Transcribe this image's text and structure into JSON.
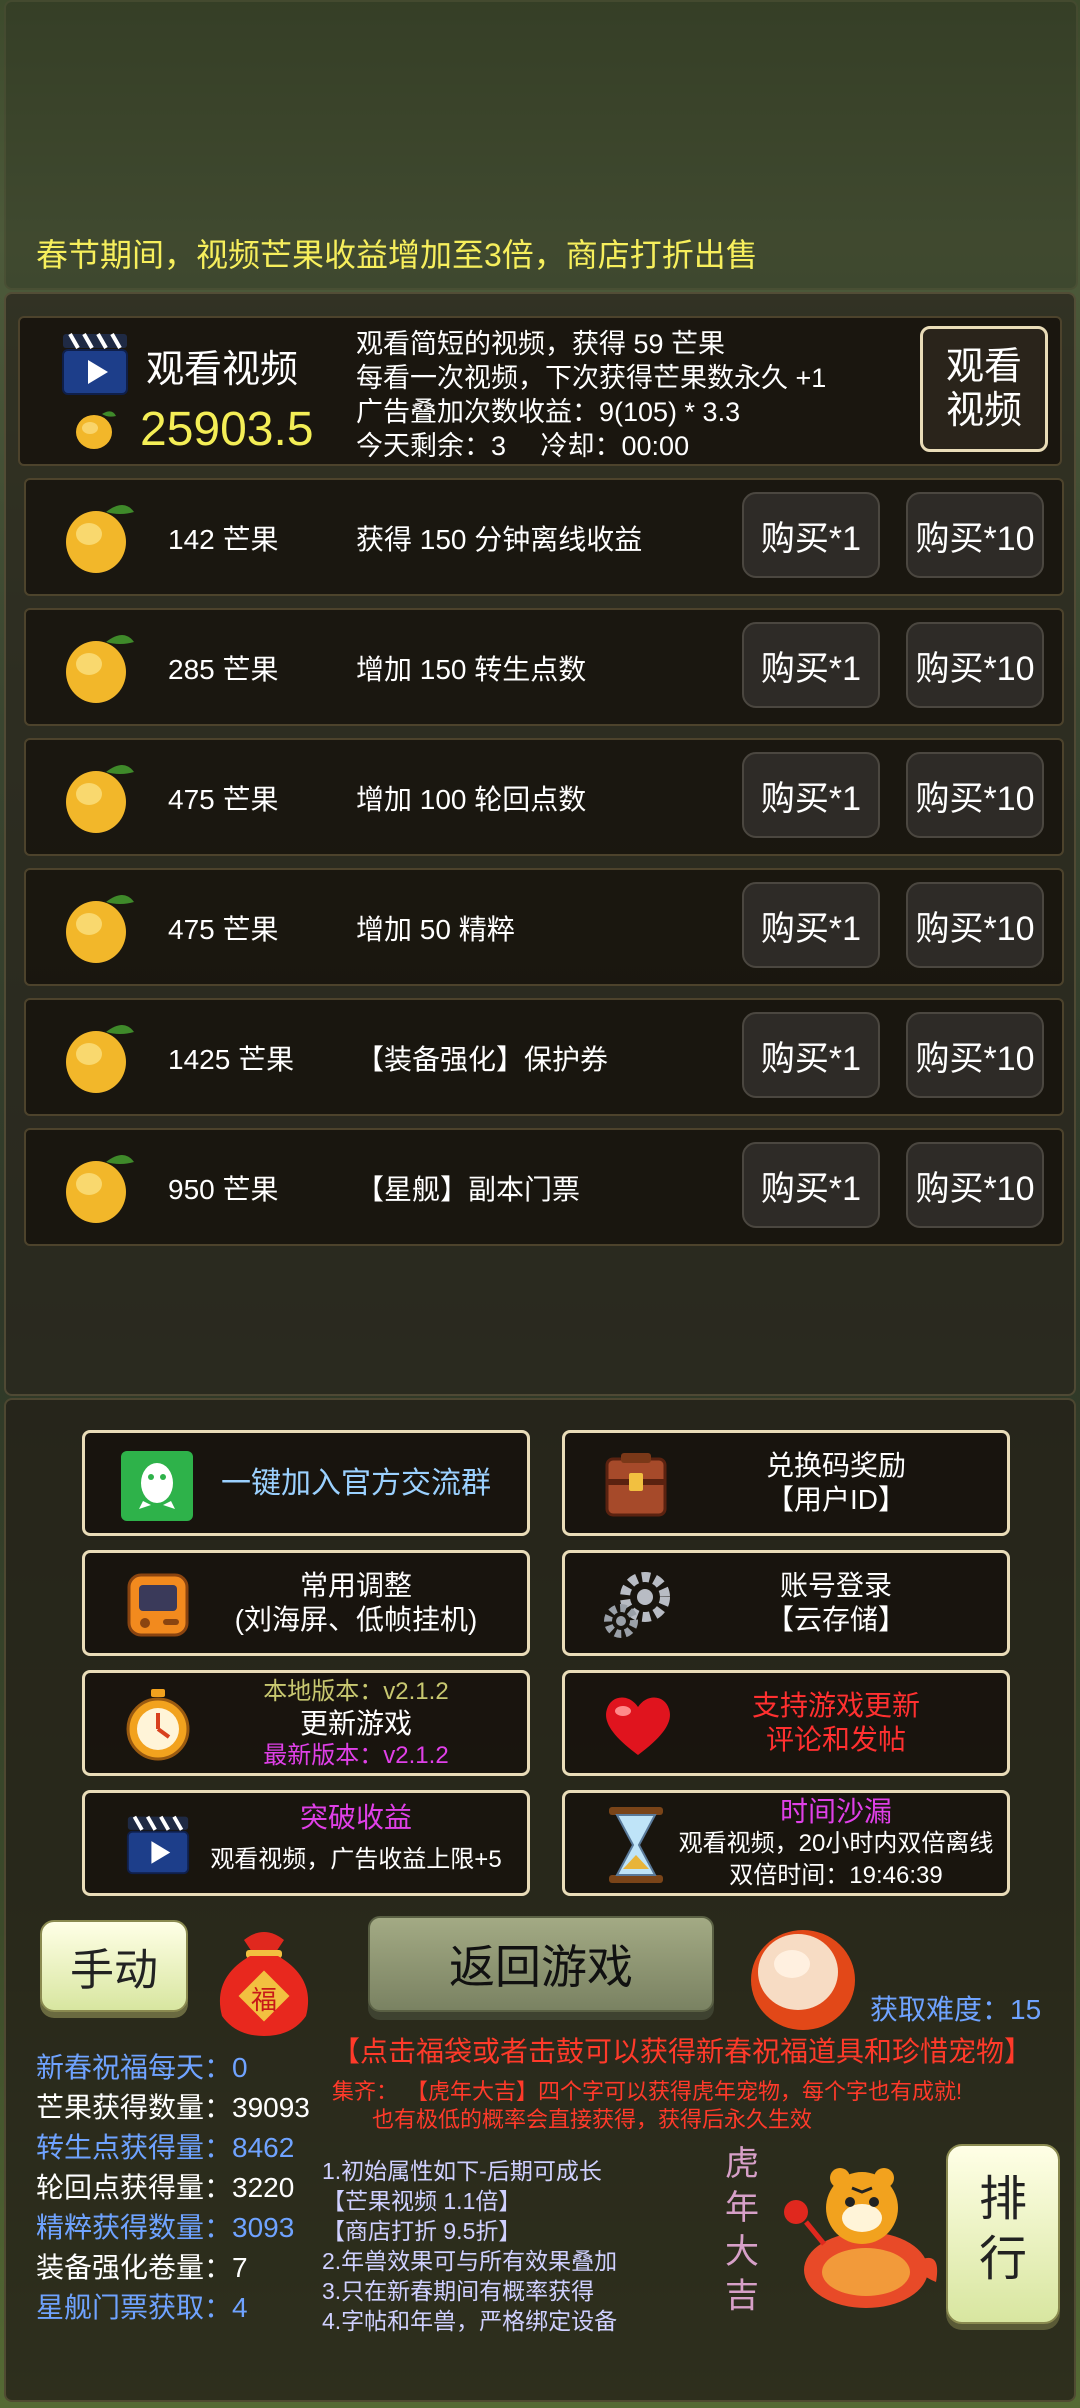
{
  "banner": "春节期间，视频芒果收益增加至3倍，商店打折出售",
  "video": {
    "title": "观看视频",
    "balance": "25903.5",
    "line1": "观看简短的视频，获得 59 芒果",
    "line2": "每看一次视频，下次获得芒果数永久 +1",
    "line3": "广告叠加次数收益：9(105) * 3.3",
    "line4": "今天剩余：3　 冷却：00:00",
    "button_line1": "观看",
    "button_line2": "视频"
  },
  "shop": {
    "buy1_label": "购买*1",
    "buy10_label": "购买*10",
    "items": [
      {
        "price": "142 芒果",
        "desc": "获得 150 分钟离线收益"
      },
      {
        "price": "285 芒果",
        "desc": "增加 150 转生点数"
      },
      {
        "price": "475 芒果",
        "desc": "增加 100 轮回点数"
      },
      {
        "price": "475 芒果",
        "desc": "增加 50 精粹"
      },
      {
        "price": "1425 芒果",
        "desc": "【装备强化】保护券"
      },
      {
        "price": "950 芒果",
        "desc": "【星舰】副本门票"
      }
    ]
  },
  "menu": {
    "join_group": "一键加入官方交流群",
    "redeem_line1": "兑换码奖励",
    "redeem_line2": "【用户ID】",
    "settings_line1": "常用调整",
    "settings_line2": "(刘海屏、低帧挂机)",
    "login_line1": "账号登录",
    "login_line2": "【云存储】",
    "local_version": "本地版本：v2.1.2",
    "update_game": "更新游戏",
    "latest_version": "最新版本：v2.1.2",
    "support_line1": "支持游戏更新",
    "support_line2": "评论和发帖",
    "breakthrough_title": "突破收益",
    "breakthrough_desc": "观看视频，广告收益上限+5",
    "hourglass_title": "时间沙漏",
    "hourglass_desc": "观看视频，20小时内双倍离线",
    "double_time": "双倍时间：19:46:39"
  },
  "bottom": {
    "manual_button": "手动",
    "return_button": "返回游戏",
    "fu_char": "福",
    "difficulty": "获取难度：15",
    "hint": "【点击福袋或者击鼓可以获得新春祝福道具和珍惜宠物】",
    "collect_label": "集齐：",
    "collect_text": "【虎年大吉】四个字可以获得虎年宠物，每个字也有成就!",
    "collect_text2": "也有极低的概率会直接获得，获得后永久生效",
    "stats": [
      {
        "label": "新春祝福每天：",
        "value": "0"
      },
      {
        "label": "芒果获得数量：",
        "value": "39093"
      },
      {
        "label": "转生点获得量：",
        "value": "8462"
      },
      {
        "label": "轮回点获得量：",
        "value": "3220"
      },
      {
        "label": "精粹获得数量：",
        "value": "3093"
      },
      {
        "label": "装备强化卷量：",
        "value": "7"
      },
      {
        "label": "星舰门票获取：",
        "value": "4"
      }
    ],
    "notes": [
      "1.初始属性如下-后期可成长",
      "【芒果视频 1.1倍】",
      "【商店打折 9.5折】",
      "2.年兽效果可与所有效果叠加",
      "3.只在新春期间有概率获得",
      "4.字帖和年兽，严格绑定设备"
    ],
    "tiger_chars": [
      "虎",
      "年",
      "大",
      "吉"
    ],
    "rank_line1": "排",
    "rank_line2": "行"
  },
  "colors": {
    "banner_yellow": "#f7ef5c",
    "balance_yellow": "#f4ee56",
    "stat_blue": "#6fa3ff",
    "notice_red": "#ff3a2a",
    "note_lavender": "#cfd0ff"
  }
}
